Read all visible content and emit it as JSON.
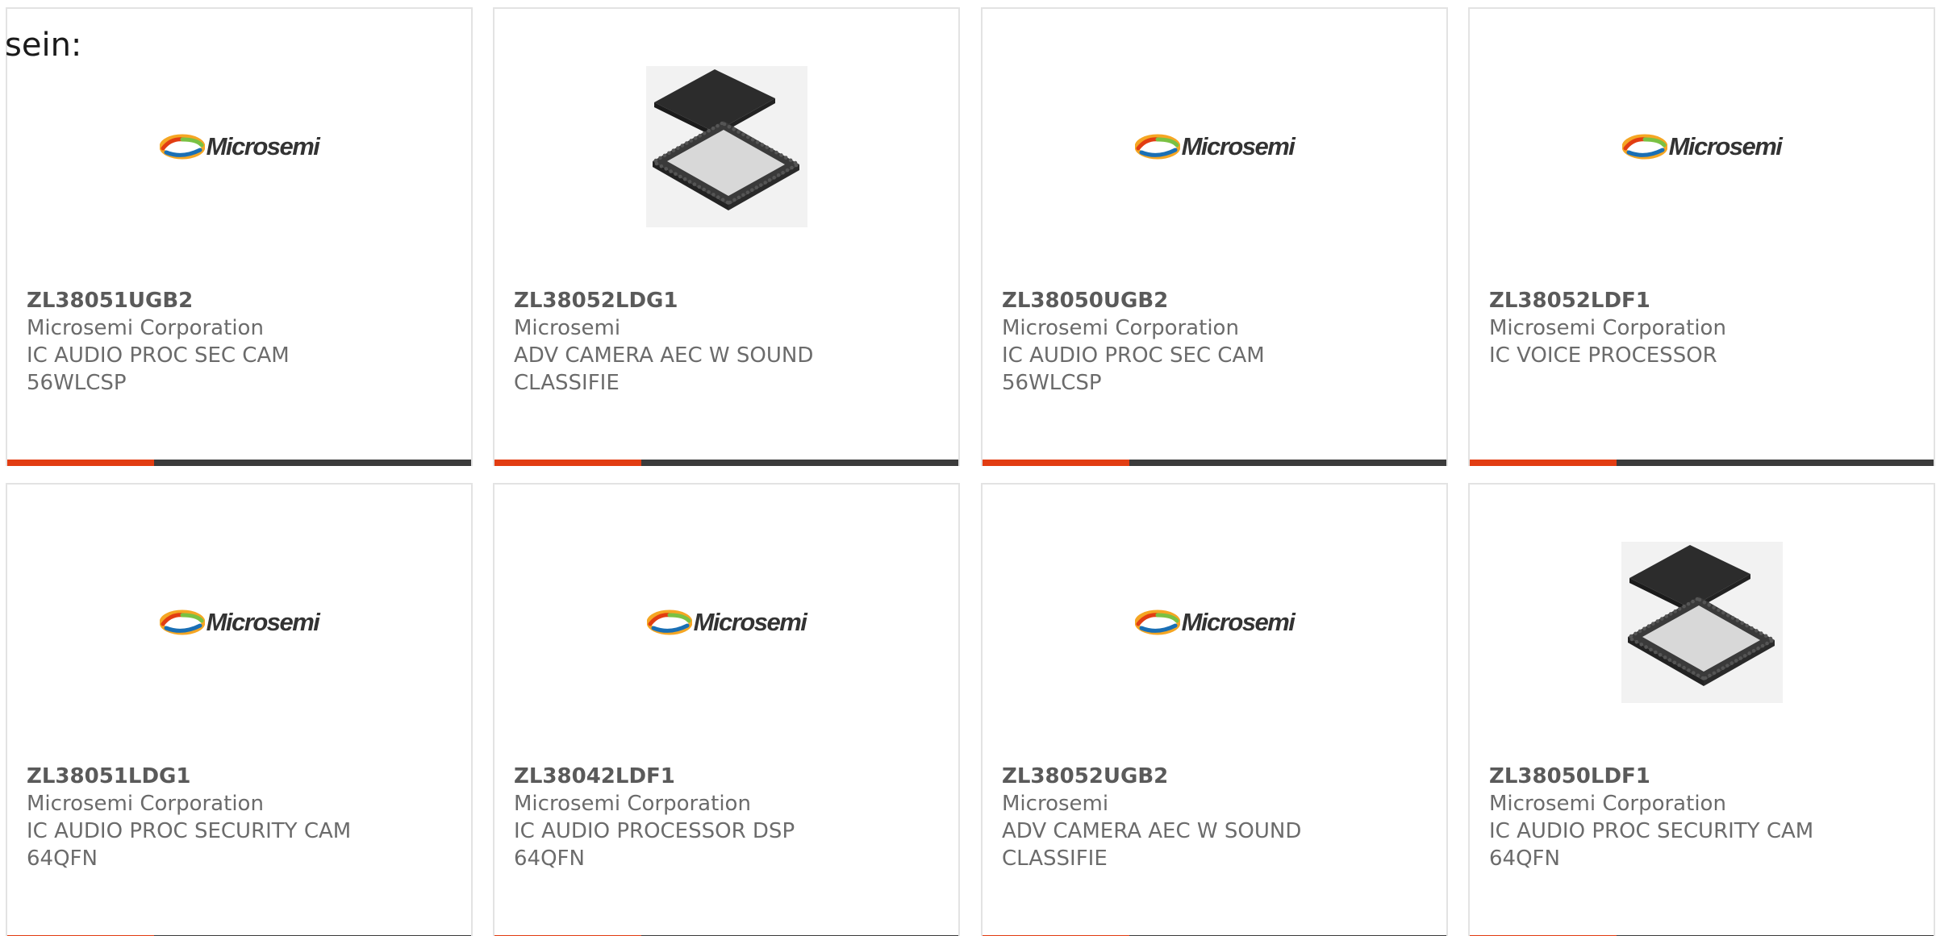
{
  "intro_text": "sein:",
  "brand_logo_text": "Microsemi",
  "colors": {
    "accent_bar": "#e23d12",
    "bar": "#3b3b3b",
    "card_border": "#e3e3e3",
    "text": "#6b6b6b"
  },
  "products": [
    {
      "part_number": "ZL38051UGB2",
      "manufacturer": "Microsemi Corporation",
      "description": "IC AUDIO PROC SEC CAM\n56WLCSP",
      "image": "microsemi-logo"
    },
    {
      "part_number": "ZL38052LDG1",
      "manufacturer": "Microsemi",
      "description": "ADV CAMERA AEC W SOUND\nCLASSIFIE",
      "image": "qfn-chip"
    },
    {
      "part_number": "ZL38050UGB2",
      "manufacturer": "Microsemi Corporation",
      "description": "IC AUDIO PROC SEC CAM\n56WLCSP",
      "image": "microsemi-logo"
    },
    {
      "part_number": "ZL38052LDF1",
      "manufacturer": "Microsemi Corporation",
      "description": "IC VOICE PROCESSOR",
      "image": "microsemi-logo"
    },
    {
      "part_number": "ZL38051LDG1",
      "manufacturer": "Microsemi Corporation",
      "description": "IC AUDIO PROC SECURITY CAM\n64QFN",
      "image": "microsemi-logo"
    },
    {
      "part_number": "ZL38042LDF1",
      "manufacturer": "Microsemi Corporation",
      "description": "IC AUDIO PROCESSOR DSP\n64QFN",
      "image": "microsemi-logo"
    },
    {
      "part_number": "ZL38052UGB2",
      "manufacturer": "Microsemi",
      "description": "ADV CAMERA AEC W SOUND\nCLASSIFIE",
      "image": "microsemi-logo"
    },
    {
      "part_number": "ZL38050LDF1",
      "manufacturer": "Microsemi Corporation",
      "description": "IC AUDIO PROC SECURITY CAM\n64QFN",
      "image": "qfn-chip"
    }
  ]
}
